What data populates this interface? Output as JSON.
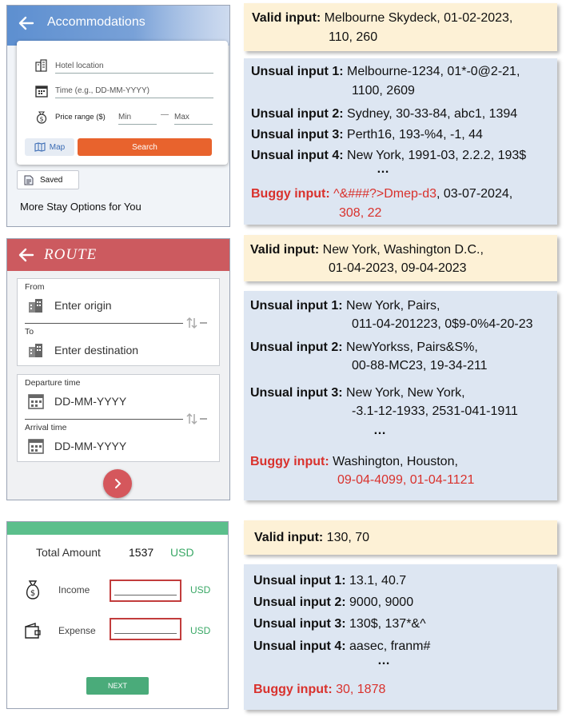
{
  "accommodations": {
    "title": "Accommodations",
    "location_placeholder": "Hotel location",
    "time_placeholder": "Time (e.g., DD-MM-YYYY)",
    "price_label": "Price range ($)",
    "min_placeholder": "Min",
    "dash": "—",
    "max_placeholder": "Max",
    "map_label": "Map",
    "search_label": "Search",
    "saved_label": "Saved",
    "more_label": "More Stay Options for You"
  },
  "route": {
    "title": "ROUTE",
    "from_label": "From",
    "origin_placeholder": "Enter origin",
    "to_label": "To",
    "destination_placeholder": "Enter destination",
    "departure_label": "Departure time",
    "departure_placeholder": "DD-MM-YYYY",
    "arrival_label": "Arrival time",
    "arrival_placeholder": "DD-MM-YYYY"
  },
  "budget": {
    "total_label": "Total Amount",
    "total_value": "1537",
    "total_currency": "USD",
    "income_label": "Income",
    "income_currency": "USD",
    "expense_label": "Expense",
    "expense_currency": "USD",
    "next_label": "NEXT"
  },
  "annotations": {
    "valid_label": "Valid input",
    "buggy_label": "Buggy input",
    "ellipsis": "…",
    "colors": {
      "buggy": "#d9312c",
      "valid_bg": "#fdf1d6",
      "unusual_bg": "#dde6f2"
    },
    "group1": {
      "valid_line1": "Melbourne Skydeck, 01-02-2023,",
      "valid_line2": "110, 260",
      "unusual": [
        {
          "label": "Unsual input 1",
          "line1": "Melbourne-1234, 01*-0@2-21,",
          "line2": "1100, 2609"
        },
        {
          "label": "Unsual input 2",
          "line1": "Sydney, 30-33-84, abc1, 1394"
        },
        {
          "label": "Unsual input 3",
          "line1": "Perth16, 193-%4, -1, 44"
        },
        {
          "label": "Unsual input 4",
          "line1": "New York, 1991-03, 2.2.2, 193$"
        }
      ],
      "buggy_part1": "^&###?>Dmep-d3",
      "buggy_part2": ", 03-07-2024,",
      "buggy_line2": "308, 22"
    },
    "group2": {
      "valid_line1": "New York, Washington D.C.,",
      "valid_line2": "01-04-2023, 09-04-2023",
      "unusual": [
        {
          "label": "Unsual input 1",
          "line1": "New York, Pairs,",
          "line2": "011-04-201223, 0$9-0%4-20-23"
        },
        {
          "label": "Unsual input 2",
          "line1": "NewYorkss, Pairs&S%,",
          "line2": "00-88-MC23, 19-34-211"
        },
        {
          "label": "Unsual input 3",
          "line1": "New York, New York,",
          "line2": "-3.1-12-1933, 2531-041-1911"
        }
      ],
      "buggy_line1": "Washington, Houston,",
      "buggy_line2": "09-04-4099, 01-04-1121"
    },
    "group3": {
      "valid_value": "130, 70",
      "unusual": [
        {
          "label": "Unsual input 1",
          "line1": "13.1, 40.7"
        },
        {
          "label": "Unsual input 2",
          "line1": "9000, 9000"
        },
        {
          "label": "Unsual input 3",
          "line1": "130$, 137*&^"
        },
        {
          "label": "Unsual input 4",
          "line1": "aasec, franm#"
        }
      ],
      "buggy_value": "30, 1878"
    }
  }
}
